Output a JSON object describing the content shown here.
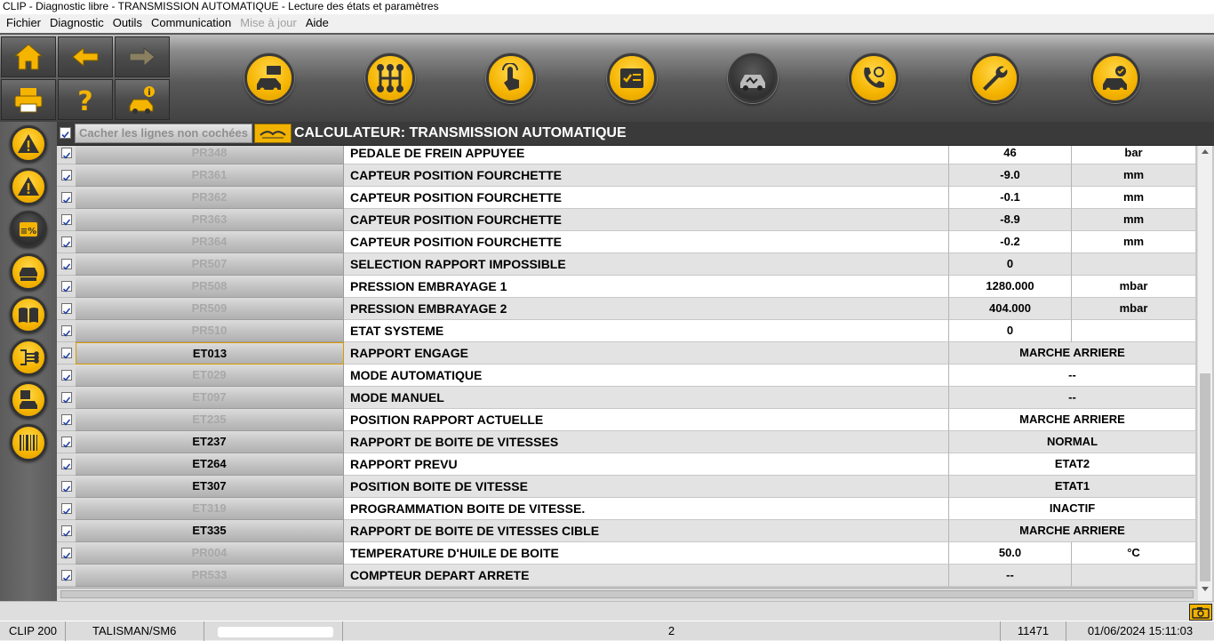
{
  "window": {
    "title": "CLIP - Diagnostic libre - TRANSMISSION AUTOMATIQUE - Lecture des états et paramètres"
  },
  "menu": [
    {
      "label": "Fichier",
      "enabled": true
    },
    {
      "label": "Diagnostic",
      "enabled": true
    },
    {
      "label": "Outils",
      "enabled": true
    },
    {
      "label": "Communication",
      "enabled": true
    },
    {
      "label": "Mise à jour",
      "enabled": false
    },
    {
      "label": "Aide",
      "enabled": true
    }
  ],
  "nav_icons": [
    "home-icon",
    "back-arrow-icon",
    "forward-arrow-icon",
    "printer-icon",
    "help-icon",
    "vehicle-info-icon"
  ],
  "top_icons": [
    "vehicle-message-icon",
    "gearbox-icon",
    "touch-test-icon",
    "checklist-icon",
    "vehicle-scan-icon",
    "phone-support-icon",
    "wrench-icon",
    "vehicle-check-icon"
  ],
  "side_icons": [
    "warning-icon",
    "warning-alt-icon",
    "parameters-percent-icon",
    "vehicle-bus-icon",
    "manual-book-icon",
    "wiring-icon",
    "vehicle-save-icon",
    "barcode-icon"
  ],
  "colors": {
    "accent": "#f5b400",
    "header": "#3a3a3a",
    "toolbar": "#595959"
  },
  "header": {
    "hide_unchecked_label": "Cacher les lignes non cochées",
    "calculator_title": "CALCULATEUR: TRANSMISSION AUTOMATIQUE"
  },
  "rows": [
    {
      "code": "PR348",
      "name": "PEDALE DE FREIN APPUYEE",
      "value": "46",
      "unit": "bar",
      "active": false
    },
    {
      "code": "PR361",
      "name": "CAPTEUR POSITION FOURCHETTE",
      "value": "-9.0",
      "unit": "mm",
      "active": false
    },
    {
      "code": "PR362",
      "name": "CAPTEUR POSITION FOURCHETTE",
      "value": "-0.1",
      "unit": "mm",
      "active": false
    },
    {
      "code": "PR363",
      "name": "CAPTEUR POSITION FOURCHETTE",
      "value": "-8.9",
      "unit": "mm",
      "active": false
    },
    {
      "code": "PR364",
      "name": "CAPTEUR POSITION FOURCHETTE",
      "value": "-0.2",
      "unit": "mm",
      "active": false
    },
    {
      "code": "PR507",
      "name": "SELECTION RAPPORT IMPOSSIBLE",
      "value": "0",
      "unit": "",
      "active": false
    },
    {
      "code": "PR508",
      "name": "PRESSION EMBRAYAGE 1",
      "value": "1280.000",
      "unit": "mbar",
      "active": false
    },
    {
      "code": "PR509",
      "name": "PRESSION EMBRAYAGE 2",
      "value": "404.000",
      "unit": "mbar",
      "active": false
    },
    {
      "code": "PR510",
      "name": "ETAT SYSTEME",
      "value": "0",
      "unit": "",
      "active": false
    },
    {
      "code": "ET013",
      "name": "RAPPORT ENGAGE",
      "value": "MARCHE ARRIERE",
      "unit": null,
      "active": true,
      "selected": true
    },
    {
      "code": "ET029",
      "name": "MODE AUTOMATIQUE",
      "value": "--",
      "unit": null,
      "active": false
    },
    {
      "code": "ET097",
      "name": "MODE MANUEL",
      "value": "--",
      "unit": null,
      "active": false
    },
    {
      "code": "ET235",
      "name": "POSITION RAPPORT ACTUELLE",
      "value": "MARCHE ARRIERE",
      "unit": null,
      "active": false
    },
    {
      "code": "ET237",
      "name": "RAPPORT DE BOITE DE VITESSES",
      "value": "NORMAL",
      "unit": null,
      "active": true
    },
    {
      "code": "ET264",
      "name": "RAPPORT PREVU",
      "value": "ETAT2",
      "unit": null,
      "active": true
    },
    {
      "code": "ET307",
      "name": "POSITION BOITE DE VITESSE",
      "value": "ETAT1",
      "unit": null,
      "active": true
    },
    {
      "code": "ET319",
      "name": "PROGRAMMATION BOITE DE VITESSE.",
      "value": "INACTIF",
      "unit": null,
      "active": false
    },
    {
      "code": "ET335",
      "name": "RAPPORT DE BOITE DE VITESSES CIBLE",
      "value": "MARCHE ARRIERE",
      "unit": null,
      "active": true
    },
    {
      "code": "PR004",
      "name": "TEMPERATURE D'HUILE DE BOITE",
      "value": "50.0",
      "unit": "°C",
      "active": false
    },
    {
      "code": "PR533",
      "name": "COMPTEUR DEPART ARRETE",
      "value": "--",
      "unit": "",
      "active": false
    }
  ],
  "status": {
    "device": "CLIP 200",
    "vehicle": "TALISMAN/SM6",
    "page": "2",
    "code": "11471",
    "datetime": "01/06/2024 15:11:03"
  }
}
